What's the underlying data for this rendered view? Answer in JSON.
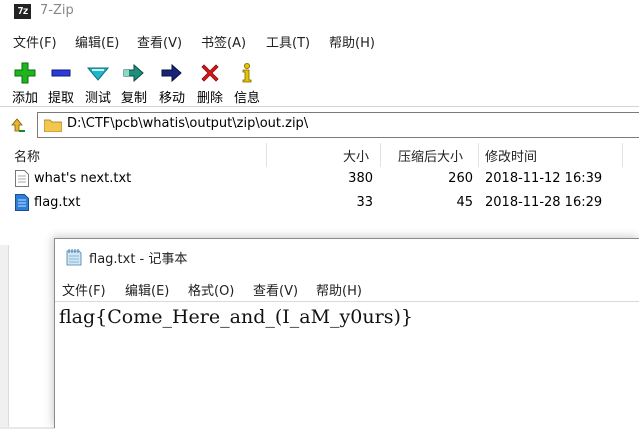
{
  "zip": {
    "title": "7-Zip",
    "menu": [
      "文件(F)",
      "编辑(E)",
      "查看(V)",
      "书签(A)",
      "工具(T)",
      "帮助(H)"
    ],
    "toolbar": {
      "add": "添加",
      "extract": "提取",
      "test": "测试",
      "copy": "复制",
      "move": "移动",
      "delete": "删除",
      "info": "信息"
    },
    "path": "D:\\CTF\\pcb\\whatis\\output\\zip\\out.zip\\",
    "columns": {
      "name": "名称",
      "size": "大小",
      "packed": "压缩后大小",
      "modified": "修改时间"
    },
    "files": [
      {
        "name": "what's next.txt",
        "size": "380",
        "packed": "260",
        "modified": "2018-11-12 16:39"
      },
      {
        "name": "flag.txt",
        "size": "33",
        "packed": "45",
        "modified": "2018-11-28 16:29"
      }
    ],
    "colors": {
      "add": "#1fb51f",
      "extract": "#2b3bd9",
      "test": "#1fb7c9",
      "copy": "#1d8f7a",
      "move": "#17247a",
      "delete": "#e01616",
      "info": "#e8c400"
    }
  },
  "notepad": {
    "title": "flag.txt - 记事本",
    "menu": [
      "文件(F)",
      "编辑(E)",
      "格式(O)",
      "查看(V)",
      "帮助(H)"
    ],
    "content": "flag{Come_Here_and_(I_aM_y0urs)}"
  }
}
